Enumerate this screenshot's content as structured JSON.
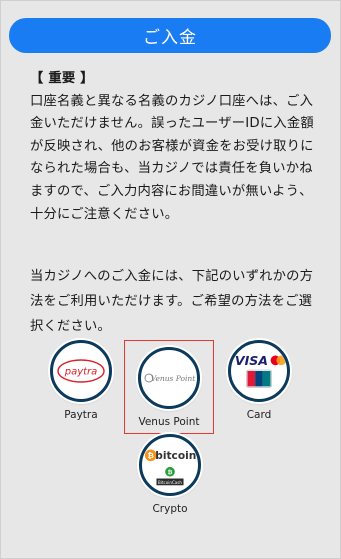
{
  "header": {
    "deposit_button": "ご入金"
  },
  "notice": {
    "title": "【 重要 】",
    "body": "口座名義と異なる名義のカジノ口座へは、ご入金いただけません。誤ったユーザーIDに入金額が反映され、他のお客様が資金をお受け取りになられた場合も、当カジノでは責任を負いかねますので、ご入力内容にお間違いが無いよう、十分にご注意ください。"
  },
  "intro": "当カジノへのご入金には、下記のいずれかの方法をご利用いただけます。ご希望の方法をご選択ください。",
  "methods": [
    {
      "label": "Paytra",
      "logo_text": "paytra",
      "icon": "paytra-logo-icon",
      "color": "#d8232a"
    },
    {
      "label": "Venus Point",
      "logo_text": "Venus Point",
      "icon": "venus-point-logo-icon",
      "color": "#8a8a8a",
      "selected": true
    },
    {
      "label": "Card",
      "logo_text": "VISA",
      "icon": "card-brands-icon",
      "color": "#1a1f71"
    },
    {
      "label": "Crypto",
      "logo_text": "bitcoin",
      "sub_text": "BitcoinCash",
      "icon": "bitcoin-logo-icon",
      "color": "#f7931a"
    }
  ]
}
